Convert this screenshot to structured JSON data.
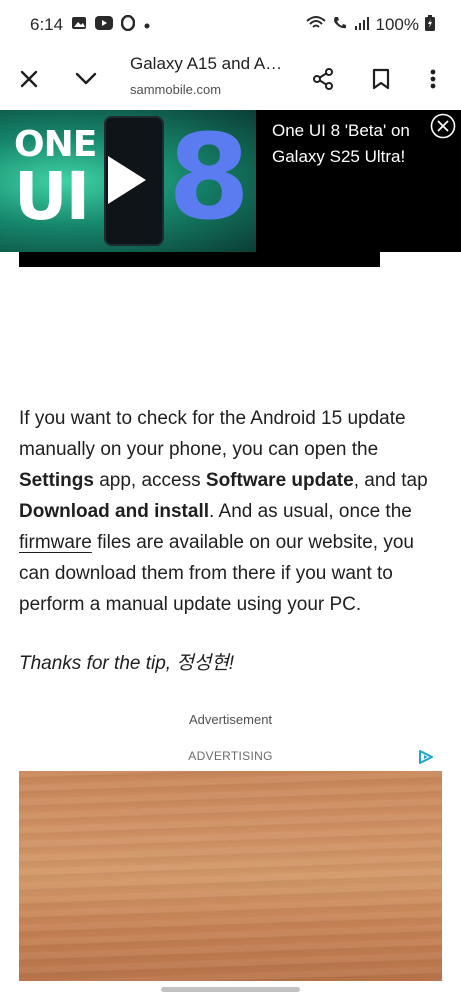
{
  "status_bar": {
    "time": "6:14",
    "battery_percent": "100%",
    "icons": [
      "gallery-icon",
      "youtube-icon",
      "opera-icon",
      "dot-icon",
      "wifi-icon",
      "wifi-calling-icon",
      "signal-icon",
      "battery-icon"
    ]
  },
  "toolbar": {
    "title": "Galaxy A15 and A…",
    "url": "sammobile.com",
    "icons": [
      "close-icon",
      "chevron-down-icon",
      "share-icon",
      "bookmark-icon",
      "more-vert-icon"
    ]
  },
  "video": {
    "thumb_top": "ONE",
    "thumb_mid": "UI",
    "thumb_num": "8",
    "title": "One UI 8 'Beta' on Galaxy S25 Ultra!"
  },
  "article": {
    "p1_a": "If you want to check for the Android 15 update manually on your phone, you can open the ",
    "p1_settings": "Settings",
    "p1_b": " app, access ",
    "p1_software": "Software update",
    "p1_c": ", and tap ",
    "p1_download": "Download and install",
    "p1_d": ". And as usual, once the ",
    "p1_firmware": "firmware",
    "p1_e": " files are available on our website, you can download them from there if you want to perform a manual update using your PC.",
    "tip": "Thanks for the tip, 정성현!"
  },
  "ad": {
    "label": "Advertisement",
    "advertising": "ADVERTISING"
  },
  "colors": {
    "accent_blue": "#5a7cf0",
    "adchoice": "#1aa7c9"
  }
}
